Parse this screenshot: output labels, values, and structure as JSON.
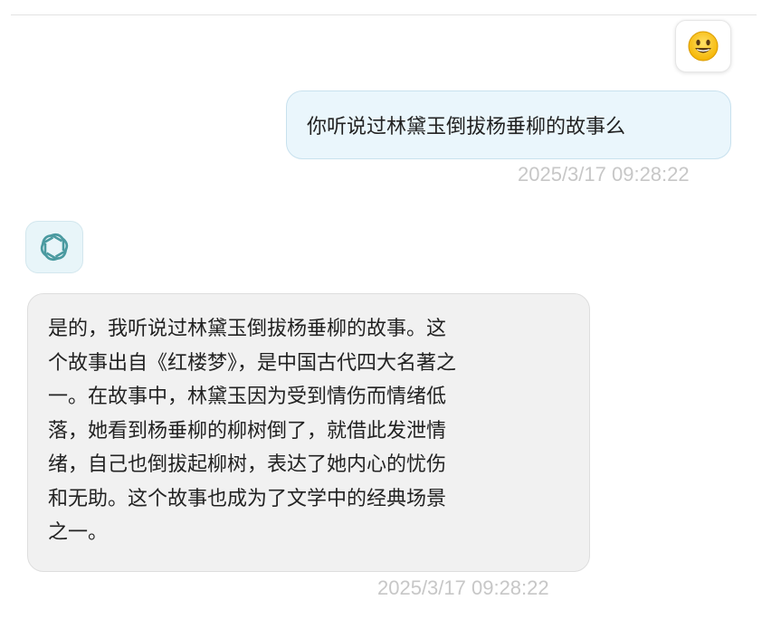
{
  "user_message": {
    "avatar": "smiley-face-emoji",
    "text": "你听说过林黛玉倒拔杨垂柳的故事么",
    "timestamp": "2025/3/17 09:28:22"
  },
  "assistant_message": {
    "avatar": "openai-logo-icon",
    "lines": [
      "是的，我听说过林黛玉倒拔杨垂柳的故事。这",
      "个故事出自《红楼梦》，是中国古代四大名著之",
      "一。在故事中，林黛玉因为受到情伤而情绪低",
      "落，她看到杨垂柳的柳树倒了，就借此发泄情",
      "绪，自己也倒拔起柳树，表达了她内心的忧伤",
      "和无助。这个故事也成为了文学中的经典场景",
      "之一。"
    ],
    "timestamp": "2025/3/17 09:28:22"
  },
  "colors": {
    "user_bubble": "#eaf6fc",
    "assistant_bubble": "#f1f1f1",
    "timestamp": "#c7c7c7",
    "logo": "#4a9aa0"
  }
}
